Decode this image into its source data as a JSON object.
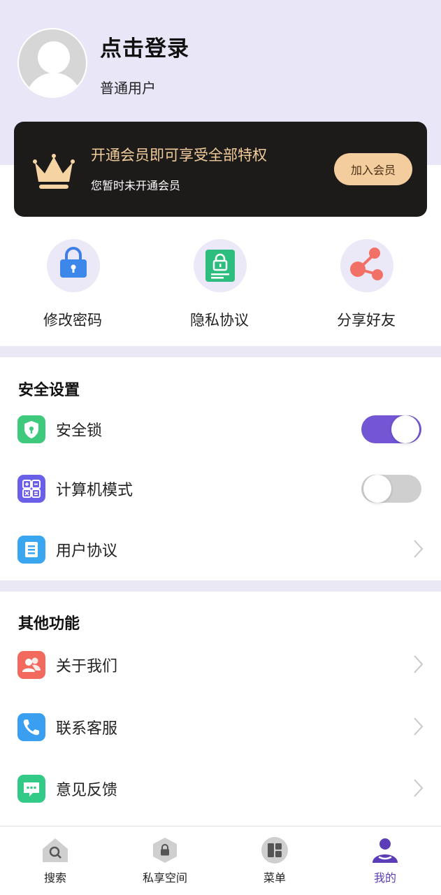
{
  "profile": {
    "login_title": "点击登录",
    "user_type": "普通用户"
  },
  "vip": {
    "title": "开通会员即可享受全部特权",
    "subtitle": "您暂时未开通会员",
    "join_button": "加入会员",
    "accent_color": "#f3cd9d"
  },
  "quick_actions": [
    {
      "label": "修改密码",
      "icon": "lock-icon"
    },
    {
      "label": "隐私协议",
      "icon": "privacy-doc-icon"
    },
    {
      "label": "分享好友",
      "icon": "share-icon"
    }
  ],
  "security": {
    "title": "安全设置",
    "items": [
      {
        "label": "安全锁",
        "icon": "shield-icon",
        "control": "toggle",
        "enabled": true
      },
      {
        "label": "计算机模式",
        "icon": "calculator-icon",
        "control": "toggle",
        "enabled": false
      },
      {
        "label": "用户协议",
        "icon": "document-icon",
        "control": "chevron"
      }
    ]
  },
  "other": {
    "title": "其他功能",
    "items": [
      {
        "label": "关于我们",
        "icon": "users-icon"
      },
      {
        "label": "联系客服",
        "icon": "phone-icon"
      },
      {
        "label": "意见反馈",
        "icon": "message-icon"
      }
    ]
  },
  "tabbar": {
    "items": [
      {
        "label": "搜索",
        "icon": "search-home-icon",
        "active": false
      },
      {
        "label": "私享空间",
        "icon": "private-space-icon",
        "active": false
      },
      {
        "label": "菜单",
        "icon": "menu-grid-icon",
        "active": false
      },
      {
        "label": "我的",
        "icon": "profile-icon",
        "active": true
      }
    ],
    "active_color": "#5c3db8"
  },
  "theme": {
    "header_bg": "#e9e7f7",
    "toggle_on": "#7256d4"
  }
}
